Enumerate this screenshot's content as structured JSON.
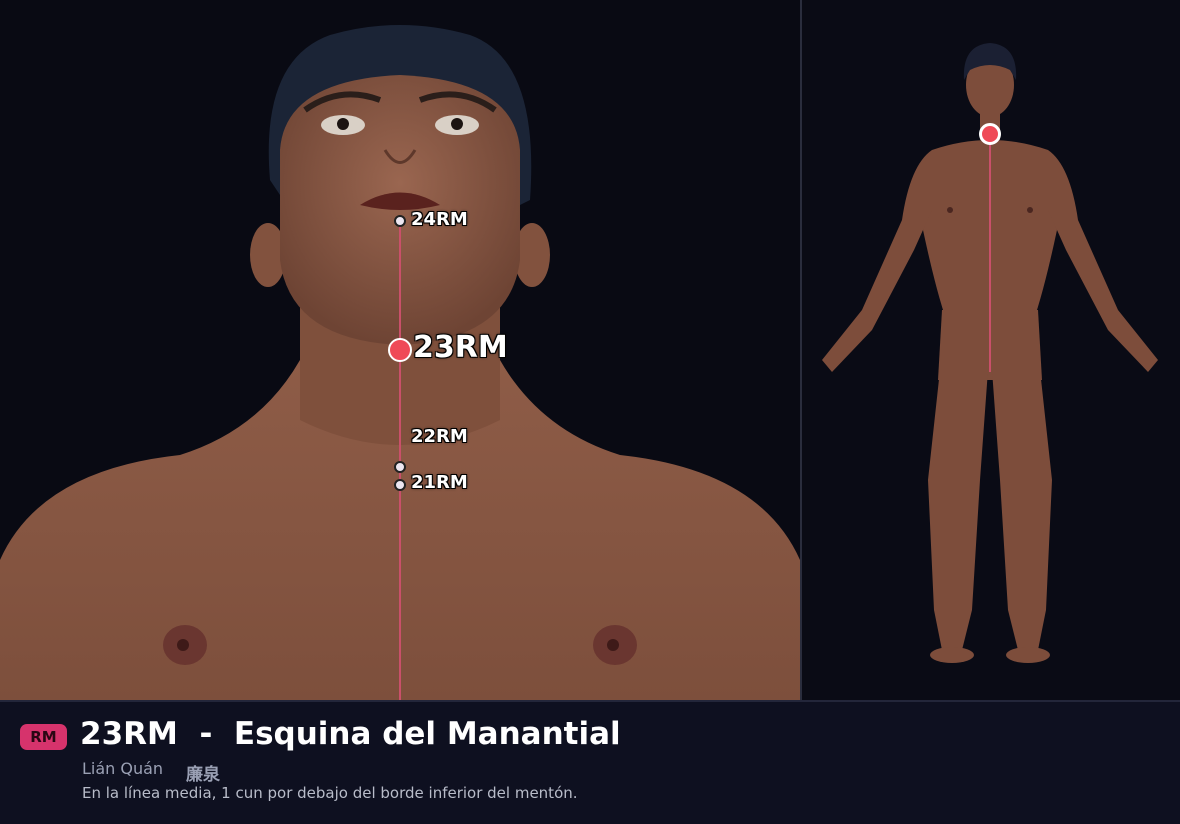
{
  "main_view": {
    "points": [
      {
        "id": "24RM",
        "label": "24RM",
        "size": "small"
      },
      {
        "id": "23RM",
        "label": "23RM",
        "size": "big",
        "selected": true
      },
      {
        "id": "22RM",
        "label": "22RM",
        "size": "small"
      },
      {
        "id": "21RM",
        "label": "21RM",
        "size": "small"
      }
    ]
  },
  "side_view": {
    "highlighted_point": "23RM"
  },
  "info": {
    "meridian_badge": "RM",
    "title": "23RM  -  Esquina del Manantial",
    "pinyin": "Lián Quán",
    "hanzi": "廉泉",
    "description": "En la línea media, 1 cun por debajo del borde inferior del mentón."
  },
  "colors": {
    "background": "#0b0c14",
    "accent_point": "#ef4a57",
    "badge": "#d6336c",
    "meridian_line": "#c9506a",
    "skin": "#8a5a45"
  }
}
